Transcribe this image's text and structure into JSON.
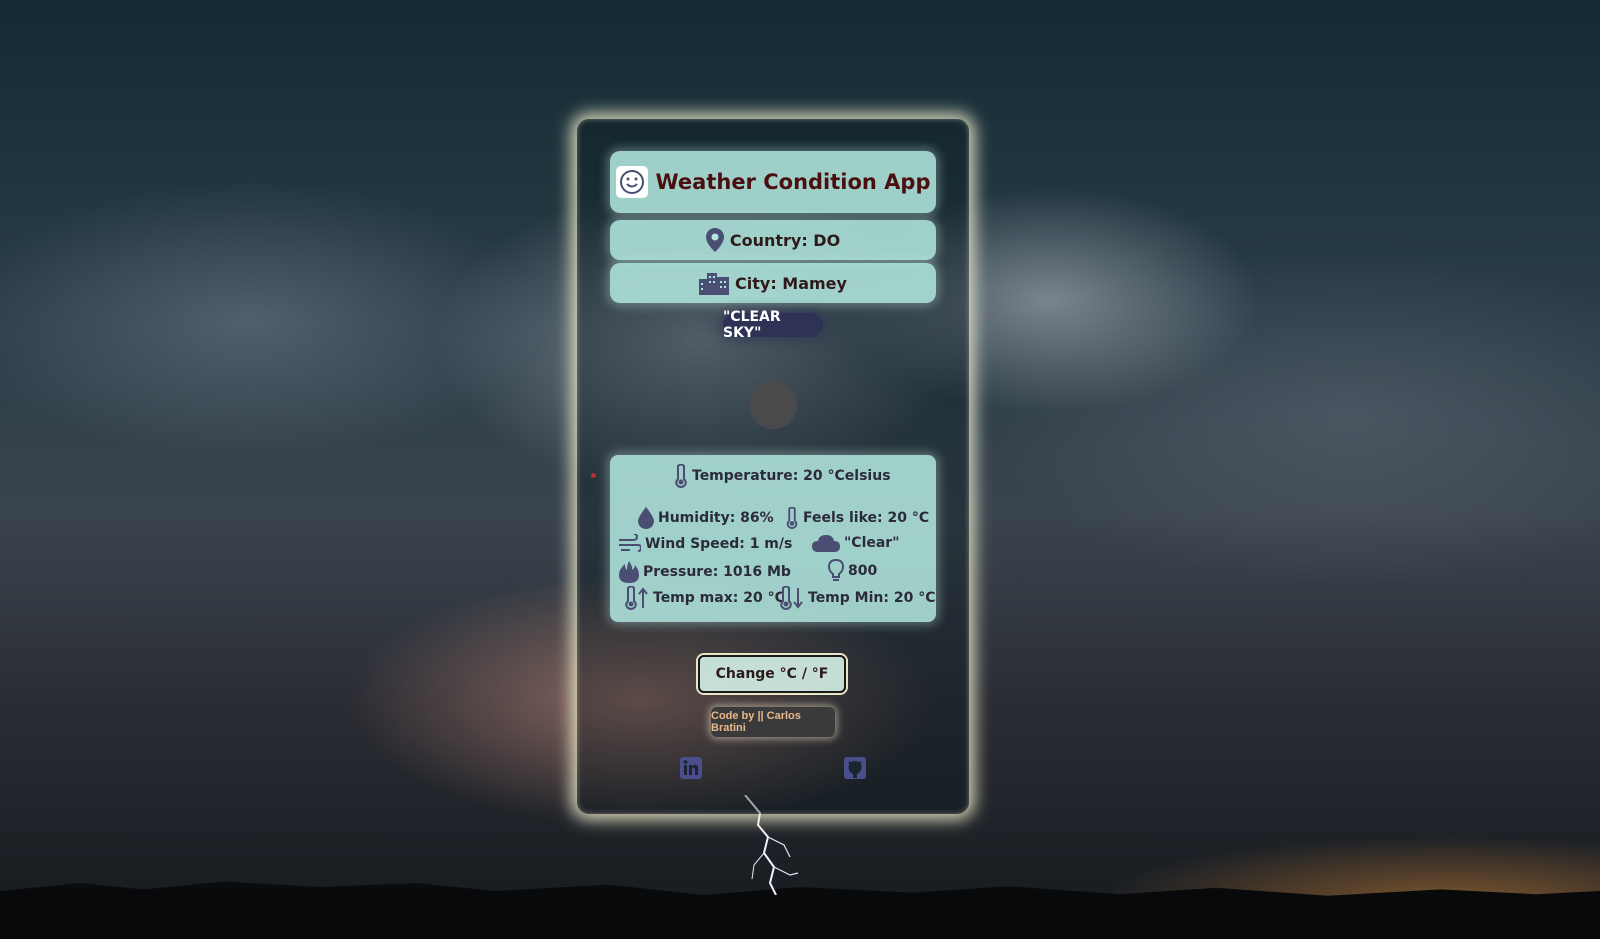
{
  "app": {
    "title": "Weather Condition App"
  },
  "location": {
    "country_label": "Country: DO",
    "city_label": "City: Mamey"
  },
  "condition": {
    "description": "\"CLEAR SKY\""
  },
  "details": {
    "temperature": "Temperature: 20 °Celsius",
    "humidity": "Humidity: 86%",
    "feels_like": "Feels like: 20 °C",
    "wind_speed": "Wind Speed: 1 m/s",
    "main": "\"Clear\"",
    "pressure": "Pressure: 1016 Mb",
    "code": "800",
    "temp_max": "Temp max: 20 °C",
    "temp_min": "Temp Min: 20 °C"
  },
  "actions": {
    "change_units_label": "Change °C / °F"
  },
  "footer": {
    "credit": "Code by || Carlos Bratini"
  },
  "icons": {
    "title": "smile-icon",
    "country": "map-pin-icon",
    "city": "city-icon",
    "temperature": "thermometer-icon",
    "humidity": "droplet-icon",
    "feels_like": "thermometer-icon",
    "wind": "wind-icon",
    "main": "cloud-icon",
    "pressure": "fire-icon",
    "code": "lightbulb-icon",
    "temp_max": "thermometer-up-icon",
    "temp_min": "thermometer-down-icon",
    "linkedin": "linkedin-icon",
    "github": "github-icon"
  },
  "colors": {
    "panel": "#b2e6de",
    "title_text": "#4a1010",
    "badge_bg": "#2e3356",
    "card_glow": "#eeecd0",
    "icon": "#4a4e72",
    "credit_text": "#e8b88a"
  }
}
